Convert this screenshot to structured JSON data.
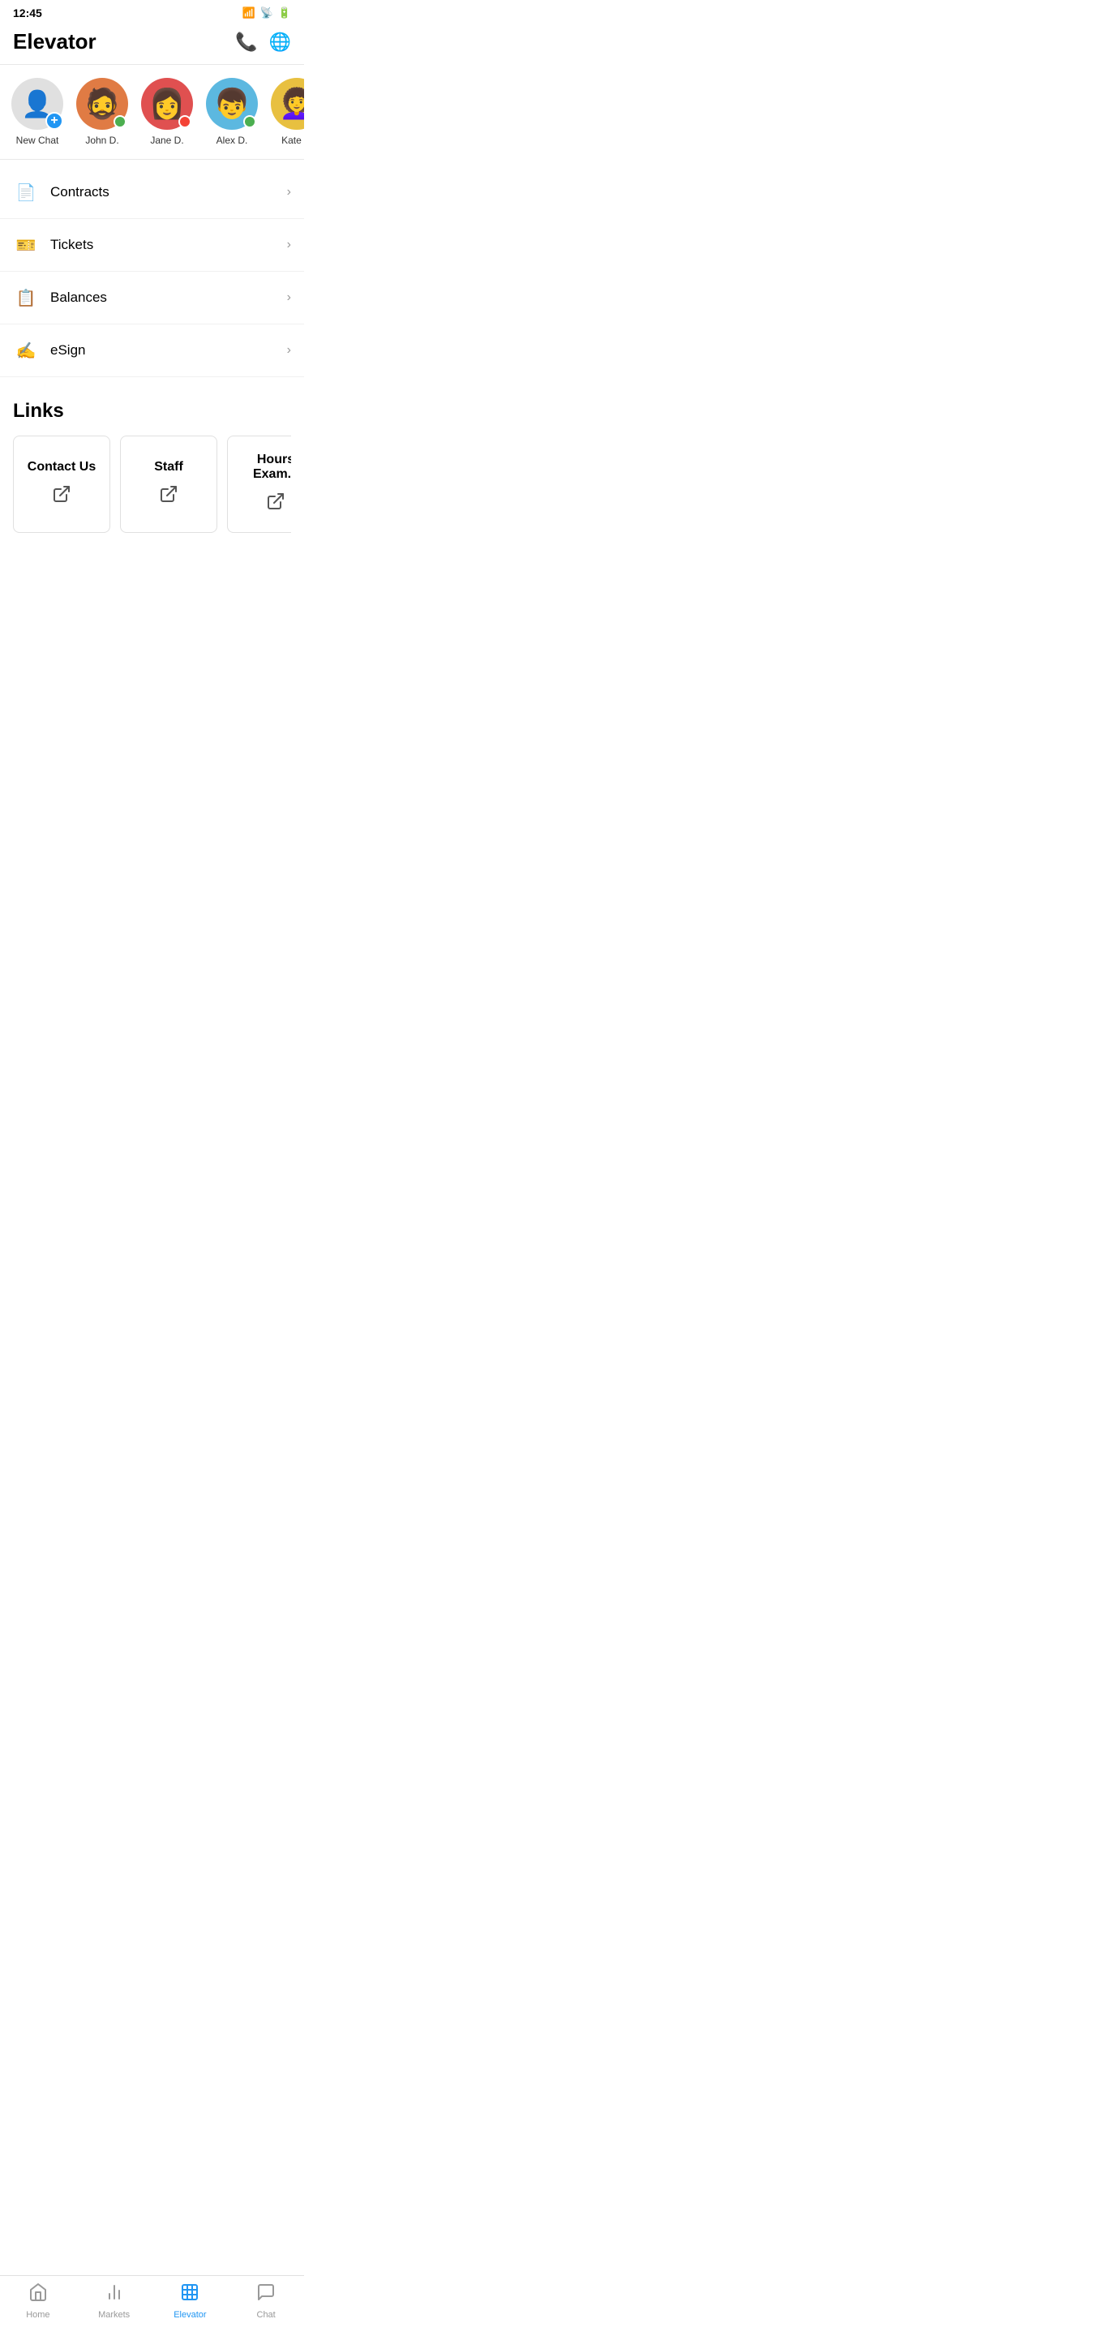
{
  "statusBar": {
    "time": "12:45",
    "icons": [
      "📶",
      "🔋"
    ]
  },
  "header": {
    "title": "Elevator",
    "phoneIcon": "📞",
    "globeIcon": "🌐"
  },
  "contacts": [
    {
      "id": "new-chat",
      "name": "New Chat",
      "type": "new",
      "statusColor": ""
    },
    {
      "id": "john",
      "name": "John D.",
      "type": "avatar",
      "statusColor": "online",
      "avatarClass": "avatar-john",
      "emoji": "🧔"
    },
    {
      "id": "jane",
      "name": "Jane D.",
      "type": "avatar",
      "statusColor": "offline",
      "avatarClass": "avatar-jane",
      "emoji": "👩"
    },
    {
      "id": "alex",
      "name": "Alex D.",
      "type": "avatar",
      "statusColor": "online",
      "avatarClass": "avatar-alex",
      "emoji": "👦"
    },
    {
      "id": "kate",
      "name": "Kate P.",
      "type": "avatar",
      "statusColor": "offline",
      "avatarClass": "avatar-kate",
      "emoji": "👩‍🦱"
    }
  ],
  "menuItems": [
    {
      "id": "contracts",
      "label": "Contracts",
      "icon": "📄"
    },
    {
      "id": "tickets",
      "label": "Tickets",
      "icon": "🎫"
    },
    {
      "id": "balances",
      "label": "Balances",
      "icon": "📋"
    },
    {
      "id": "esign",
      "label": "eSign",
      "icon": "✍️"
    }
  ],
  "linksSection": {
    "title": "Links",
    "links": [
      {
        "id": "contact-us",
        "label": "Contact Us"
      },
      {
        "id": "staff",
        "label": "Staff"
      },
      {
        "id": "hours-exam",
        "label": "Hours Exam..."
      }
    ]
  },
  "bottomNav": [
    {
      "id": "home",
      "label": "Home",
      "icon": "🏠",
      "active": false
    },
    {
      "id": "markets",
      "label": "Markets",
      "icon": "📊",
      "active": false
    },
    {
      "id": "elevator",
      "label": "Elevator",
      "icon": "🏢",
      "active": true
    },
    {
      "id": "chat",
      "label": "Chat",
      "icon": "💬",
      "active": false
    }
  ]
}
